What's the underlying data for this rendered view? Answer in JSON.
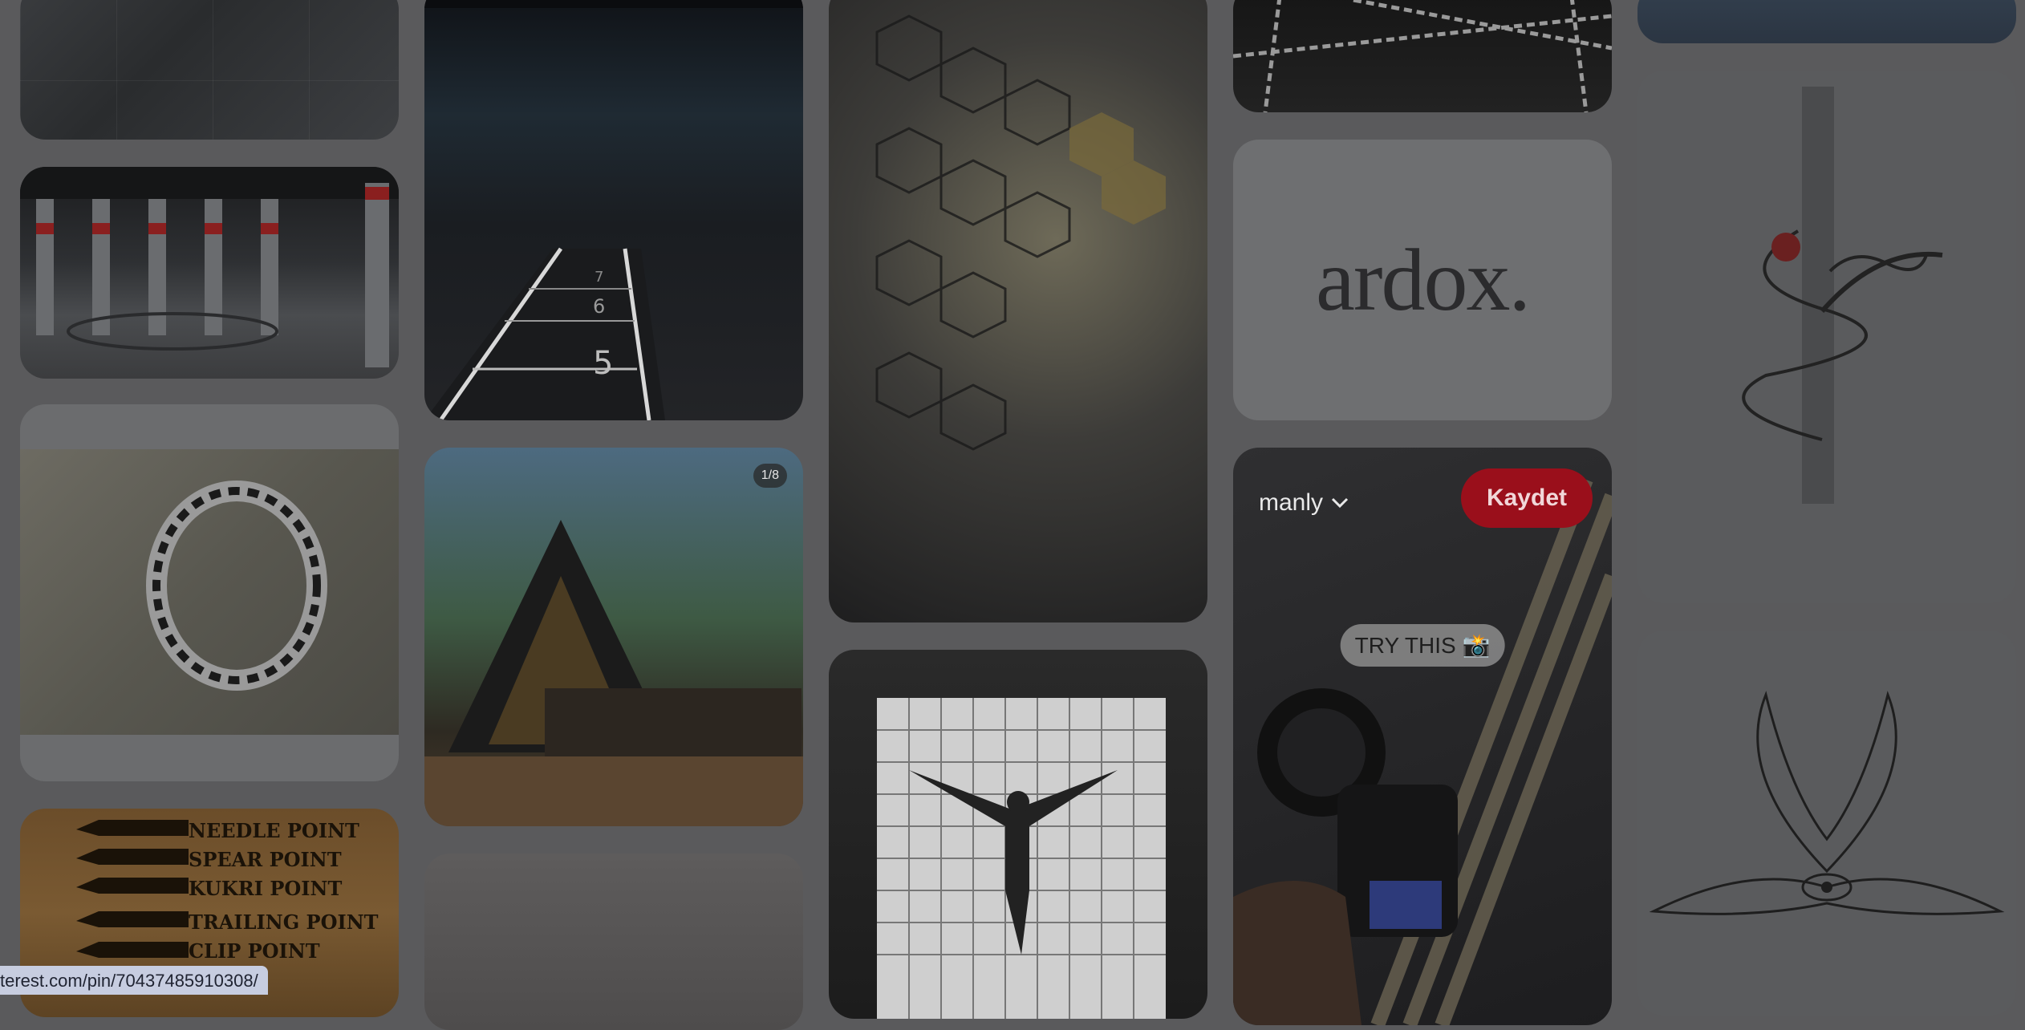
{
  "pins": {
    "knife": {
      "items": [
        "NEEDLE POINT",
        "SPEAR POINT",
        "KUKRI POINT",
        "TRAILING POINT",
        "CLIP POINT"
      ]
    },
    "gym2": {
      "lane_numbers": [
        "5",
        "6",
        "7"
      ]
    },
    "house": {
      "badge": "1/8"
    },
    "logo": {
      "text": "ardox."
    },
    "camera": {
      "board_name": "manly",
      "save_label": "Kaydet",
      "try_this": "TRY THIS 📸"
    }
  },
  "status_bar": {
    "url": "terest.com/pin/70437485910308/"
  },
  "icons": {
    "board_chevron": "chevron-down-icon"
  }
}
